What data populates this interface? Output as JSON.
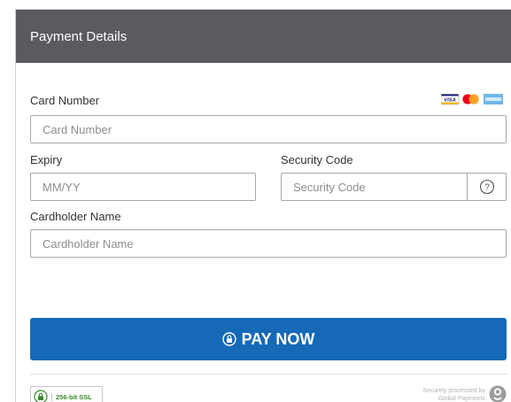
{
  "header": {
    "title": "Payment Details"
  },
  "card_number": {
    "label": "Card Number",
    "placeholder": "Card Number"
  },
  "card_logos": [
    "visa-icon",
    "mastercard-icon",
    "amex-icon"
  ],
  "visa_text": "VISA",
  "expiry": {
    "label": "Expiry",
    "placeholder": "MM/YY"
  },
  "security_code": {
    "label": "Security Code",
    "placeholder": "Security Code",
    "help_icon": "?"
  },
  "cardholder": {
    "label": "Cardholder Name",
    "placeholder": "Cardholder Name"
  },
  "pay_button": {
    "label": "PAY NOW",
    "icon": "lock-icon"
  },
  "footer": {
    "ssl_badge_text": "256-bit SSL",
    "secure_text_1": "Securely processed by",
    "secure_text_2": "Global Payments"
  },
  "colors": {
    "header_bg": "#595b60",
    "pay_button_bg": "#1669b7",
    "ssl_green": "#3a8a2e"
  }
}
